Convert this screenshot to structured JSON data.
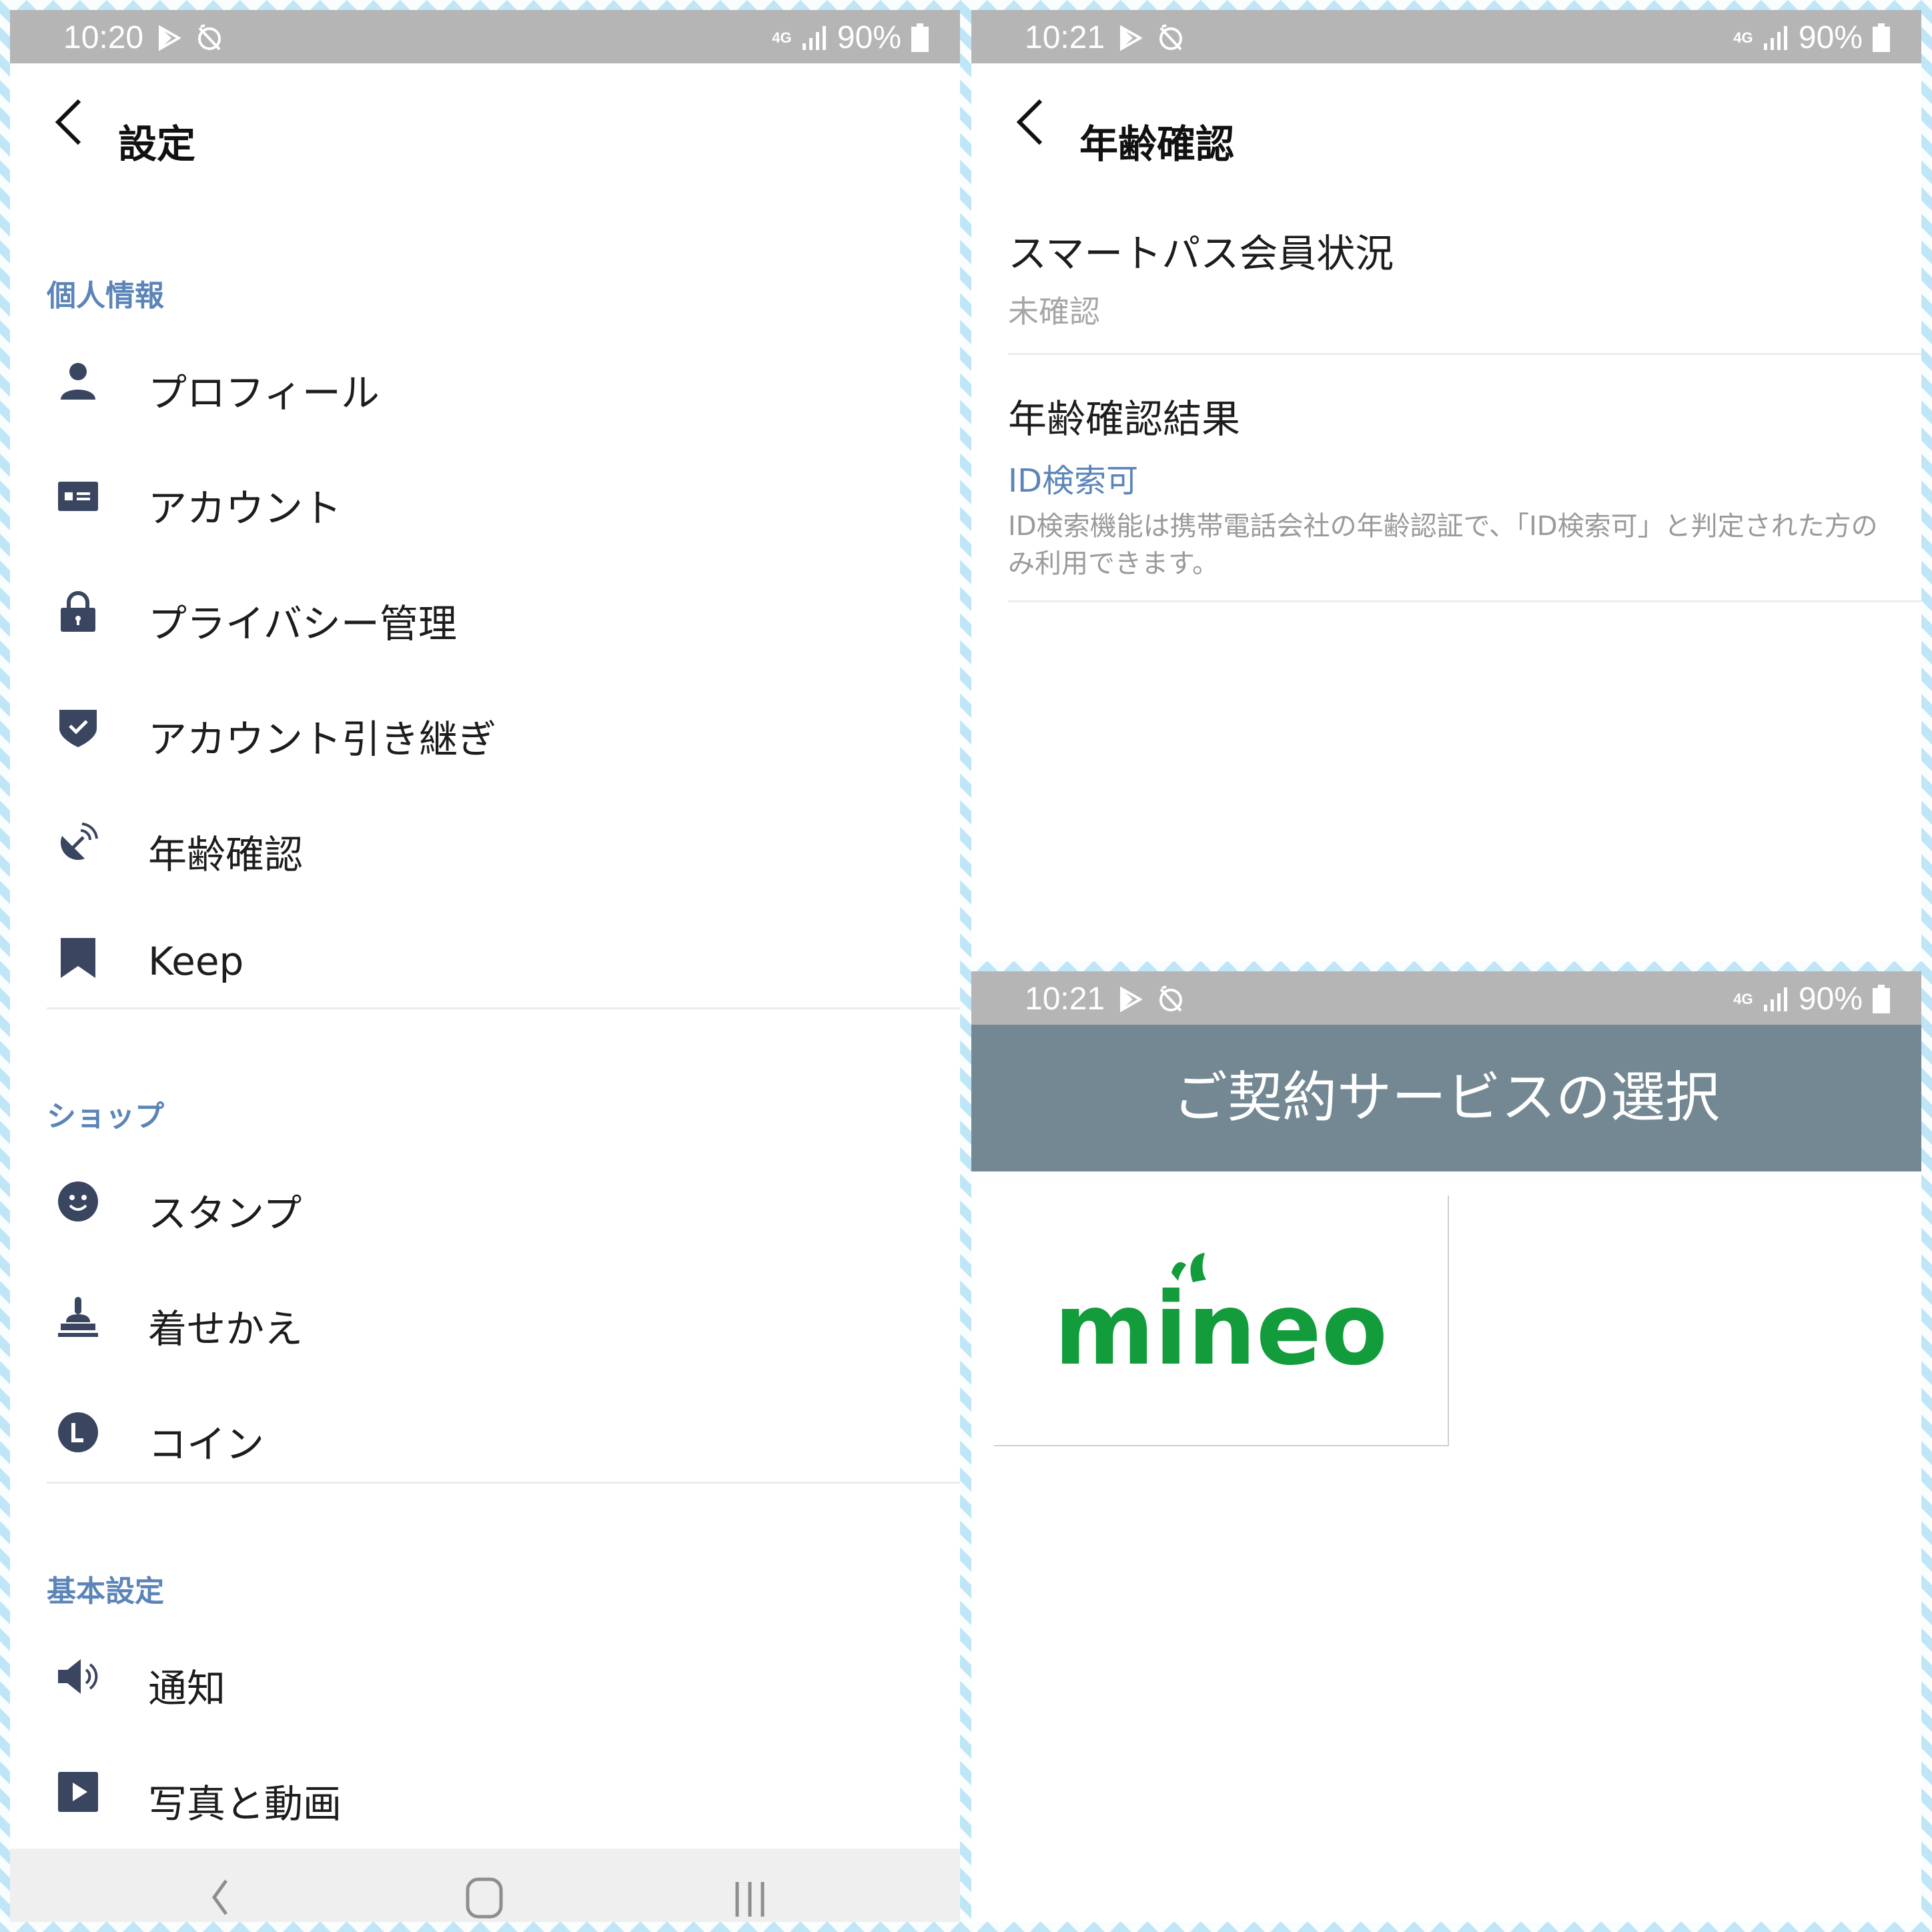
{
  "settings_panel": {
    "status": {
      "time": "10:20",
      "network": "4G",
      "battery": "90%"
    },
    "title": "設定",
    "sections": [
      {
        "label": "個人情報",
        "items": [
          {
            "label": "プロフィール",
            "icon": "person-icon"
          },
          {
            "label": "アカウント",
            "icon": "id-card-icon"
          },
          {
            "label": "プライバシー管理",
            "icon": "lock-icon"
          },
          {
            "label": "アカウント引き継ぎ",
            "icon": "shield-check-icon"
          },
          {
            "label": "年齢確認",
            "icon": "satellite-dish-icon"
          },
          {
            "label": "Keep",
            "icon": "bookmark-icon"
          }
        ]
      },
      {
        "label": "ショップ",
        "items": [
          {
            "label": "スタンプ",
            "icon": "smiley-icon"
          },
          {
            "label": "着せかえ",
            "icon": "stamp-icon"
          },
          {
            "label": "コイン",
            "icon": "coin-icon"
          }
        ]
      },
      {
        "label": "基本設定",
        "items": [
          {
            "label": "通知",
            "icon": "speaker-icon"
          },
          {
            "label": "写真と動画",
            "icon": "play-icon"
          }
        ]
      }
    ]
  },
  "age_panel": {
    "status": {
      "time": "10:21",
      "network": "4G",
      "battery": "90%"
    },
    "title": "年齢確認",
    "smartpass": {
      "title": "スマートパス会員状況",
      "value": "未確認"
    },
    "result": {
      "title": "年齢確認結果",
      "value": "ID検索可",
      "description": "ID検索機能は携帯電話会社の年齢認証で、「ID検索可」と判定された方のみ利用できます。"
    }
  },
  "select_panel": {
    "status": {
      "time": "10:21",
      "network": "4G",
      "battery": "90%"
    },
    "header": "ご契約サービスの選択",
    "services": [
      {
        "name": "mineo",
        "brand_color": "#139c3b"
      }
    ]
  },
  "colors": {
    "accent_blue": "#5b84b8",
    "icon_navy": "#3a4560",
    "status_bar": "#b5b5b5",
    "header_slate": "#738893"
  }
}
